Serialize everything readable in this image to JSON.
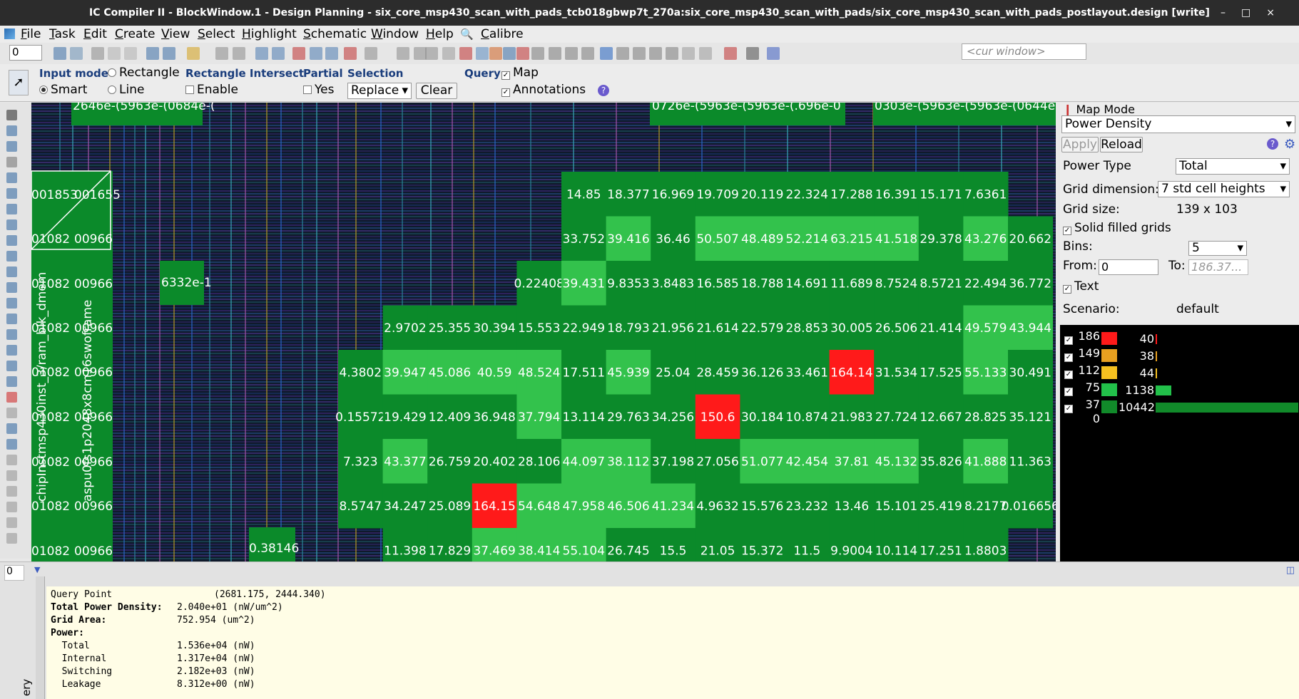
{
  "title": "IC Compiler II - BlockWindow.1 - Design Planning - six_core_msp430_scan_with_pads_tcb018gbwp7t_270a:six_core_msp430_scan_with_pads/six_core_msp430_scan_with_pads_postlayout.design [write]",
  "window_controls": [
    "–",
    "□",
    "×"
  ],
  "menus": [
    "File",
    "Task",
    "Edit",
    "Create",
    "View",
    "Select",
    "Highlight",
    "Schematic",
    "Window",
    "Help",
    "Calibre"
  ],
  "toolbar": {
    "spin_value": "0",
    "cur_window_placeholder": "<cur window>"
  },
  "options": {
    "input_mode_label": "Input mode",
    "rectangle_label": "Rectangle",
    "smart_label": "Smart",
    "line_label": "Line",
    "rect_intersect_label": "Rectangle Intersect",
    "enable_label": "Enable",
    "partial_label": "Partial",
    "yes_label": "Yes",
    "selection_label": "Selection",
    "selection_value": "Replace",
    "clear_label": "Clear",
    "query_label": "Query",
    "map_label": "Map",
    "annotations_label": "Annotations"
  },
  "canvas": {
    "top_labels": [
      "2646e-(5963e-(0684e-(",
      "0726e-(5963e-(5963e-(.696e-0",
      "0303e-(5963e-(5963e-(0644e-("
    ],
    "left_col": [
      "001853",
      "01082",
      "01082",
      "01082",
      "01082",
      "01082",
      "01082",
      "01082",
      "01082"
    ],
    "left_col2": [
      "001655",
      "00966",
      "00966",
      "00966",
      "00966",
      "00966",
      "00966",
      "00966",
      "00966"
    ],
    "misc_left": "6332e-1",
    "misc_bottom": "0.38146",
    "vertical_text_1": "chipInstmsp430inst_3/ram_blk_dmem",
    "vertical_text_2": "aspu0fs1p2048x8cm16swoframe",
    "grid_rows": [
      [
        "",
        "",
        "",
        "",
        "",
        "14.85",
        "18.377",
        "16.969",
        "19.709",
        "20.119",
        "22.324",
        "17.288",
        "16.391",
        "15.171",
        "7.6361",
        ""
      ],
      [
        "",
        "",
        "",
        "",
        "",
        "33.752",
        "39.416",
        "36.46",
        "50.507",
        "48.489",
        "52.214",
        "63.215",
        "41.518",
        "29.378",
        "43.276",
        "20.662"
      ],
      [
        "",
        "",
        "",
        "",
        "0.22408",
        "39.431",
        "9.8353",
        "3.8483",
        "16.585",
        "18.788",
        "14.691",
        "11.689",
        "8.7524",
        "8.5721",
        "22.494",
        "36.772"
      ],
      [
        "",
        "2.9702",
        "25.355",
        "30.394",
        "15.553",
        "22.949",
        "18.793",
        "21.956",
        "21.614",
        "22.579",
        "28.853",
        "30.005",
        "26.506",
        "21.414",
        "49.579",
        "43.944"
      ],
      [
        "4.3802",
        "39.947",
        "45.086",
        "40.59",
        "48.524",
        "17.511",
        "45.939",
        "25.04",
        "28.459",
        "36.126",
        "33.461",
        "164.14",
        "31.534",
        "17.525",
        "55.133",
        "30.491"
      ],
      [
        "0.15572",
        "19.429",
        "12.409",
        "36.948",
        "37.794",
        "13.114",
        "29.763",
        "34.256",
        "150.6",
        "30.184",
        "10.874",
        "21.983",
        "27.724",
        "12.667",
        "28.825",
        "35.121"
      ],
      [
        "7.323",
        "43.377",
        "26.759",
        "20.402",
        "28.106",
        "44.097",
        "38.112",
        "37.198",
        "27.056",
        "51.077",
        "42.454",
        "37.81",
        "45.132",
        "35.826",
        "41.888",
        "11.363"
      ],
      [
        "8.5747",
        "34.247",
        "25.089",
        "164.15",
        "54.648",
        "47.958",
        "46.506",
        "41.234",
        "4.9632",
        "15.576",
        "23.232",
        "13.46",
        "15.101",
        "25.419",
        "8.2177",
        "0.016656"
      ],
      [
        "",
        "11.398",
        "17.829",
        "37.469",
        "38.414",
        "55.104",
        "26.745",
        "15.5",
        "21.05",
        "15.372",
        "11.5",
        "9.9004",
        "10.114",
        "17.251",
        "1.8803",
        ""
      ]
    ],
    "cell_classes": [
      [
        "n",
        "n",
        "n",
        "n",
        "n",
        "d",
        "d",
        "d",
        "d",
        "d",
        "d",
        "d",
        "d",
        "d",
        "d",
        "n"
      ],
      [
        "n",
        "n",
        "n",
        "n",
        "n",
        "d",
        "l",
        "d",
        "l",
        "l",
        "l",
        "l",
        "l",
        "d",
        "l",
        "d"
      ],
      [
        "n",
        "n",
        "n",
        "n",
        "d",
        "l",
        "d",
        "d",
        "d",
        "d",
        "d",
        "d",
        "d",
        "d",
        "d",
        "d"
      ],
      [
        "n",
        "d",
        "d",
        "d",
        "d",
        "d",
        "d",
        "d",
        "d",
        "d",
        "d",
        "d",
        "d",
        "d",
        "l",
        "l"
      ],
      [
        "d",
        "l",
        "l",
        "l",
        "l",
        "d",
        "l",
        "d",
        "d",
        "d",
        "d",
        "r",
        "d",
        "d",
        "l",
        "d"
      ],
      [
        "d",
        "d",
        "d",
        "d",
        "l",
        "d",
        "d",
        "d",
        "r",
        "d",
        "d",
        "d",
        "d",
        "d",
        "d",
        "d"
      ],
      [
        "d",
        "l",
        "d",
        "d",
        "d",
        "l",
        "l",
        "d",
        "d",
        "l",
        "l",
        "l",
        "l",
        "d",
        "l",
        "d"
      ],
      [
        "d",
        "d",
        "d",
        "r",
        "l",
        "l",
        "l",
        "l",
        "d",
        "d",
        "d",
        "d",
        "d",
        "d",
        "d",
        "d"
      ],
      [
        "n",
        "d",
        "d",
        "l",
        "l",
        "l",
        "d",
        "d",
        "d",
        "d",
        "d",
        "d",
        "d",
        "d",
        "d",
        "n"
      ]
    ]
  },
  "panel": {
    "map_mode_label": "Map Mode",
    "map_mode_value": "Power Density",
    "apply_label": "Apply",
    "reload_label": "Reload",
    "power_type_label": "Power Type",
    "power_type_value": "Total",
    "grid_dim_label": "Grid dimension:",
    "grid_dim_value": "7 std cell heights",
    "grid_size_label": "Grid size:",
    "grid_size_value": "139 x 103",
    "solid_label": "Solid filled grids",
    "bins_label": "Bins:",
    "bins_value": "5",
    "from_label": "From:",
    "from_value": "0",
    "to_label": "To:",
    "to_placeholder": "186.37...",
    "text_label": "Text",
    "scenario_label": "Scenario:",
    "scenario_value": "default"
  },
  "legend": {
    "bins": [
      {
        "upper": "186",
        "count": "40",
        "color": "#ff1a1a"
      },
      {
        "upper": "149",
        "count": "38",
        "color": "#e8a020"
      },
      {
        "upper": "112",
        "count": "44",
        "color": "#f5c020"
      },
      {
        "upper": "75",
        "count": "1138",
        "color": "#22c04a"
      },
      {
        "upper": "37",
        "count": "10442",
        "color": "#118a2a"
      }
    ],
    "bottom": "0",
    "bar_fractions": [
      0.004,
      0.004,
      0.004,
      0.11,
      1.0
    ]
  },
  "query": {
    "tab_label": "ery",
    "lines": [
      {
        "label": "Query Point",
        "value": "(2681.175, 2444.340)",
        "bold": false
      },
      {
        "label": "Total Power Density:",
        "value": "2.040e+01 (nW/um^2)",
        "bold": true
      },
      {
        "label": "Grid Area:",
        "value": "752.954 (um^2)",
        "bold": true
      },
      {
        "label": "Power:",
        "value": "",
        "bold": true
      },
      {
        "label": "  Total",
        "value": "1.536e+04 (nW)",
        "bold": false
      },
      {
        "label": "  Internal",
        "value": "1.317e+04 (nW)",
        "bold": false
      },
      {
        "label": "  Switching",
        "value": "2.182e+03 (nW)",
        "bold": false
      },
      {
        "label": "  Leakage",
        "value": "8.312e+00 (nW)",
        "bold": false
      }
    ]
  },
  "colors": {
    "grid_dark": "#0b8a2a",
    "grid_light": "#33c24c",
    "grid_red": "#ff1a1a",
    "canvas_bg": "#0f1a2c"
  }
}
